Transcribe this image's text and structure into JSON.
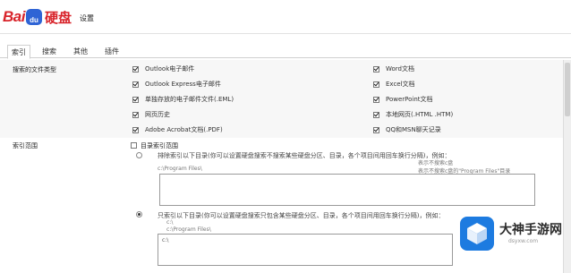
{
  "header": {
    "logo_bai": "Bai",
    "logo_du": "du",
    "logo_brand": "硬盘",
    "settings_title": "设置"
  },
  "tabs": [
    {
      "label": "索引"
    },
    {
      "label": "搜索"
    },
    {
      "label": "其他"
    },
    {
      "label": "插件"
    }
  ],
  "search_file_types": {
    "label": "搜索的文件类型",
    "left": [
      {
        "label": "Outlook电子邮件",
        "checked": true
      },
      {
        "label": "Outlook Express电子邮件",
        "checked": true
      },
      {
        "label": "单独存放的电子邮件文件(.EML)",
        "checked": true
      },
      {
        "label": "网页历史",
        "checked": true
      },
      {
        "label": "Adobe Acrobat文档(.PDF)",
        "checked": true
      }
    ],
    "right": [
      {
        "label": "Word文档",
        "checked": true
      },
      {
        "label": "Excel文档",
        "checked": true
      },
      {
        "label": "PowerPoint文档",
        "checked": true
      },
      {
        "label": "本地网页(.HTML .HTM)",
        "checked": true
      },
      {
        "label": "QQ和MSN聊天记录",
        "checked": true
      }
    ]
  },
  "index_scope": {
    "label": "索引范围",
    "target_disk_label": "目录索引范围",
    "option1_text": "排除索引以下目录(你可以设置硬盘搜索不搜索某些硬盘分区、目录，各个项目间用回车换行分隔)，例如：",
    "option1_example_path": "c:\\Program Files\\",
    "option1_hint1": "表示不搜索c盘",
    "option1_hint2": "表示不搜索c盘的\"Program Files\"目录",
    "option2_text": "只索引以下目录(你可以设置硬盘搜索只包含某些硬盘分区、目录，各个项目间用回车换行分隔)，例如：",
    "option2_example_drive": "c:\\",
    "option2_example_path": "c:\\Program Files\\",
    "option2_value": "c:\\"
  },
  "watermark": {
    "name": "大神手游网",
    "url": "dsyxw.com"
  }
}
